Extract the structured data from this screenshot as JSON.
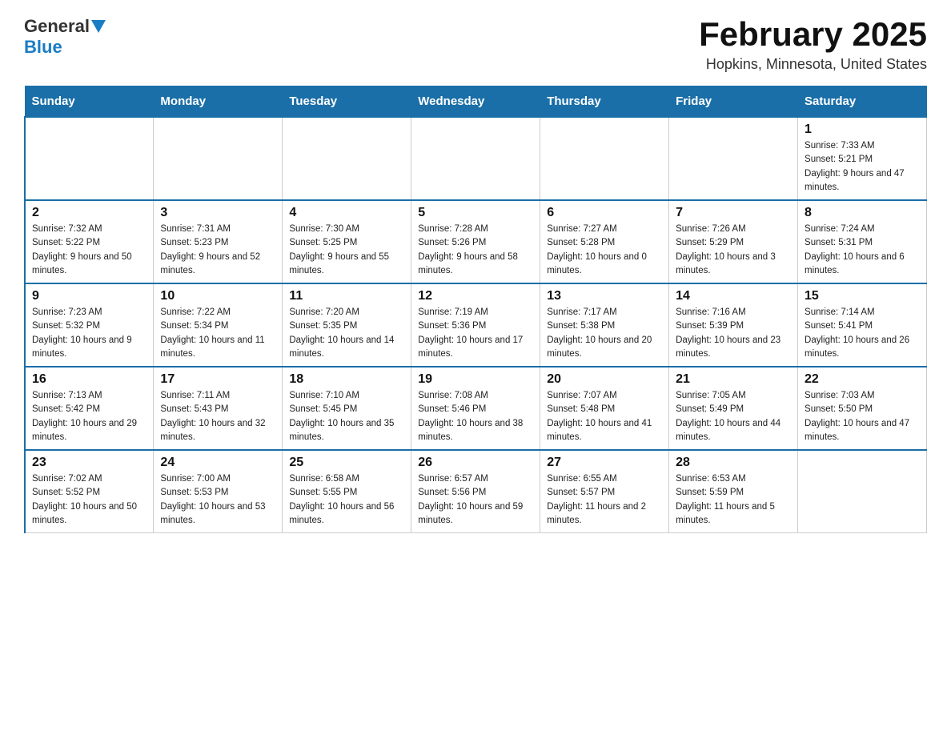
{
  "logo": {
    "text_general": "General",
    "text_blue": "Blue",
    "arrow": "▲"
  },
  "title": "February 2025",
  "location": "Hopkins, Minnesota, United States",
  "days_of_week": [
    "Sunday",
    "Monday",
    "Tuesday",
    "Wednesday",
    "Thursday",
    "Friday",
    "Saturday"
  ],
  "weeks": [
    [
      {
        "day": "",
        "info": ""
      },
      {
        "day": "",
        "info": ""
      },
      {
        "day": "",
        "info": ""
      },
      {
        "day": "",
        "info": ""
      },
      {
        "day": "",
        "info": ""
      },
      {
        "day": "",
        "info": ""
      },
      {
        "day": "1",
        "info": "Sunrise: 7:33 AM\nSunset: 5:21 PM\nDaylight: 9 hours and 47 minutes."
      }
    ],
    [
      {
        "day": "2",
        "info": "Sunrise: 7:32 AM\nSunset: 5:22 PM\nDaylight: 9 hours and 50 minutes."
      },
      {
        "day": "3",
        "info": "Sunrise: 7:31 AM\nSunset: 5:23 PM\nDaylight: 9 hours and 52 minutes."
      },
      {
        "day": "4",
        "info": "Sunrise: 7:30 AM\nSunset: 5:25 PM\nDaylight: 9 hours and 55 minutes."
      },
      {
        "day": "5",
        "info": "Sunrise: 7:28 AM\nSunset: 5:26 PM\nDaylight: 9 hours and 58 minutes."
      },
      {
        "day": "6",
        "info": "Sunrise: 7:27 AM\nSunset: 5:28 PM\nDaylight: 10 hours and 0 minutes."
      },
      {
        "day": "7",
        "info": "Sunrise: 7:26 AM\nSunset: 5:29 PM\nDaylight: 10 hours and 3 minutes."
      },
      {
        "day": "8",
        "info": "Sunrise: 7:24 AM\nSunset: 5:31 PM\nDaylight: 10 hours and 6 minutes."
      }
    ],
    [
      {
        "day": "9",
        "info": "Sunrise: 7:23 AM\nSunset: 5:32 PM\nDaylight: 10 hours and 9 minutes."
      },
      {
        "day": "10",
        "info": "Sunrise: 7:22 AM\nSunset: 5:34 PM\nDaylight: 10 hours and 11 minutes."
      },
      {
        "day": "11",
        "info": "Sunrise: 7:20 AM\nSunset: 5:35 PM\nDaylight: 10 hours and 14 minutes."
      },
      {
        "day": "12",
        "info": "Sunrise: 7:19 AM\nSunset: 5:36 PM\nDaylight: 10 hours and 17 minutes."
      },
      {
        "day": "13",
        "info": "Sunrise: 7:17 AM\nSunset: 5:38 PM\nDaylight: 10 hours and 20 minutes."
      },
      {
        "day": "14",
        "info": "Sunrise: 7:16 AM\nSunset: 5:39 PM\nDaylight: 10 hours and 23 minutes."
      },
      {
        "day": "15",
        "info": "Sunrise: 7:14 AM\nSunset: 5:41 PM\nDaylight: 10 hours and 26 minutes."
      }
    ],
    [
      {
        "day": "16",
        "info": "Sunrise: 7:13 AM\nSunset: 5:42 PM\nDaylight: 10 hours and 29 minutes."
      },
      {
        "day": "17",
        "info": "Sunrise: 7:11 AM\nSunset: 5:43 PM\nDaylight: 10 hours and 32 minutes."
      },
      {
        "day": "18",
        "info": "Sunrise: 7:10 AM\nSunset: 5:45 PM\nDaylight: 10 hours and 35 minutes."
      },
      {
        "day": "19",
        "info": "Sunrise: 7:08 AM\nSunset: 5:46 PM\nDaylight: 10 hours and 38 minutes."
      },
      {
        "day": "20",
        "info": "Sunrise: 7:07 AM\nSunset: 5:48 PM\nDaylight: 10 hours and 41 minutes."
      },
      {
        "day": "21",
        "info": "Sunrise: 7:05 AM\nSunset: 5:49 PM\nDaylight: 10 hours and 44 minutes."
      },
      {
        "day": "22",
        "info": "Sunrise: 7:03 AM\nSunset: 5:50 PM\nDaylight: 10 hours and 47 minutes."
      }
    ],
    [
      {
        "day": "23",
        "info": "Sunrise: 7:02 AM\nSunset: 5:52 PM\nDaylight: 10 hours and 50 minutes."
      },
      {
        "day": "24",
        "info": "Sunrise: 7:00 AM\nSunset: 5:53 PM\nDaylight: 10 hours and 53 minutes."
      },
      {
        "day": "25",
        "info": "Sunrise: 6:58 AM\nSunset: 5:55 PM\nDaylight: 10 hours and 56 minutes."
      },
      {
        "day": "26",
        "info": "Sunrise: 6:57 AM\nSunset: 5:56 PM\nDaylight: 10 hours and 59 minutes."
      },
      {
        "day": "27",
        "info": "Sunrise: 6:55 AM\nSunset: 5:57 PM\nDaylight: 11 hours and 2 minutes."
      },
      {
        "day": "28",
        "info": "Sunrise: 6:53 AM\nSunset: 5:59 PM\nDaylight: 11 hours and 5 minutes."
      },
      {
        "day": "",
        "info": ""
      }
    ]
  ]
}
